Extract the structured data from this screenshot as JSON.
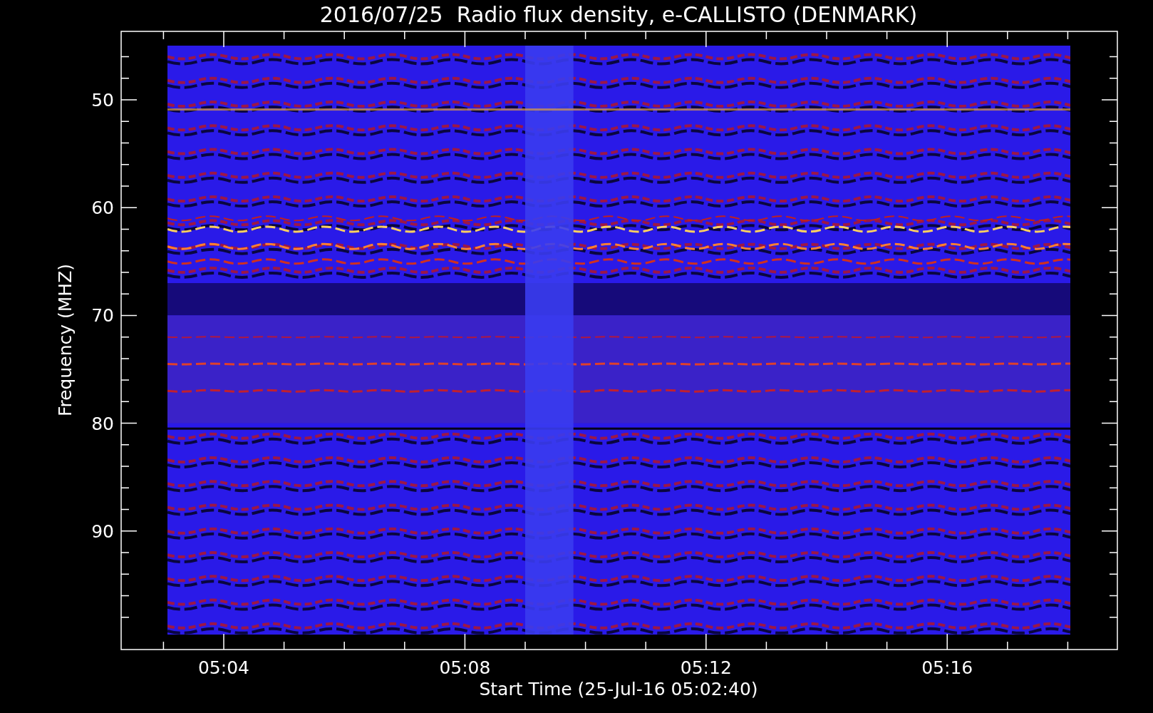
{
  "title": "2016/07/25  Radio flux density, e-CALLISTO (DENMARK)",
  "y_axis": {
    "label": "Frequency (MHZ)",
    "tick_labels": [
      "50",
      "60",
      "70",
      "80",
      "90"
    ]
  },
  "x_axis": {
    "label": "Start Time (25-Jul-16 05:02:40)",
    "tick_labels": [
      "05:04",
      "05:08",
      "05:12",
      "05:16"
    ]
  }
}
